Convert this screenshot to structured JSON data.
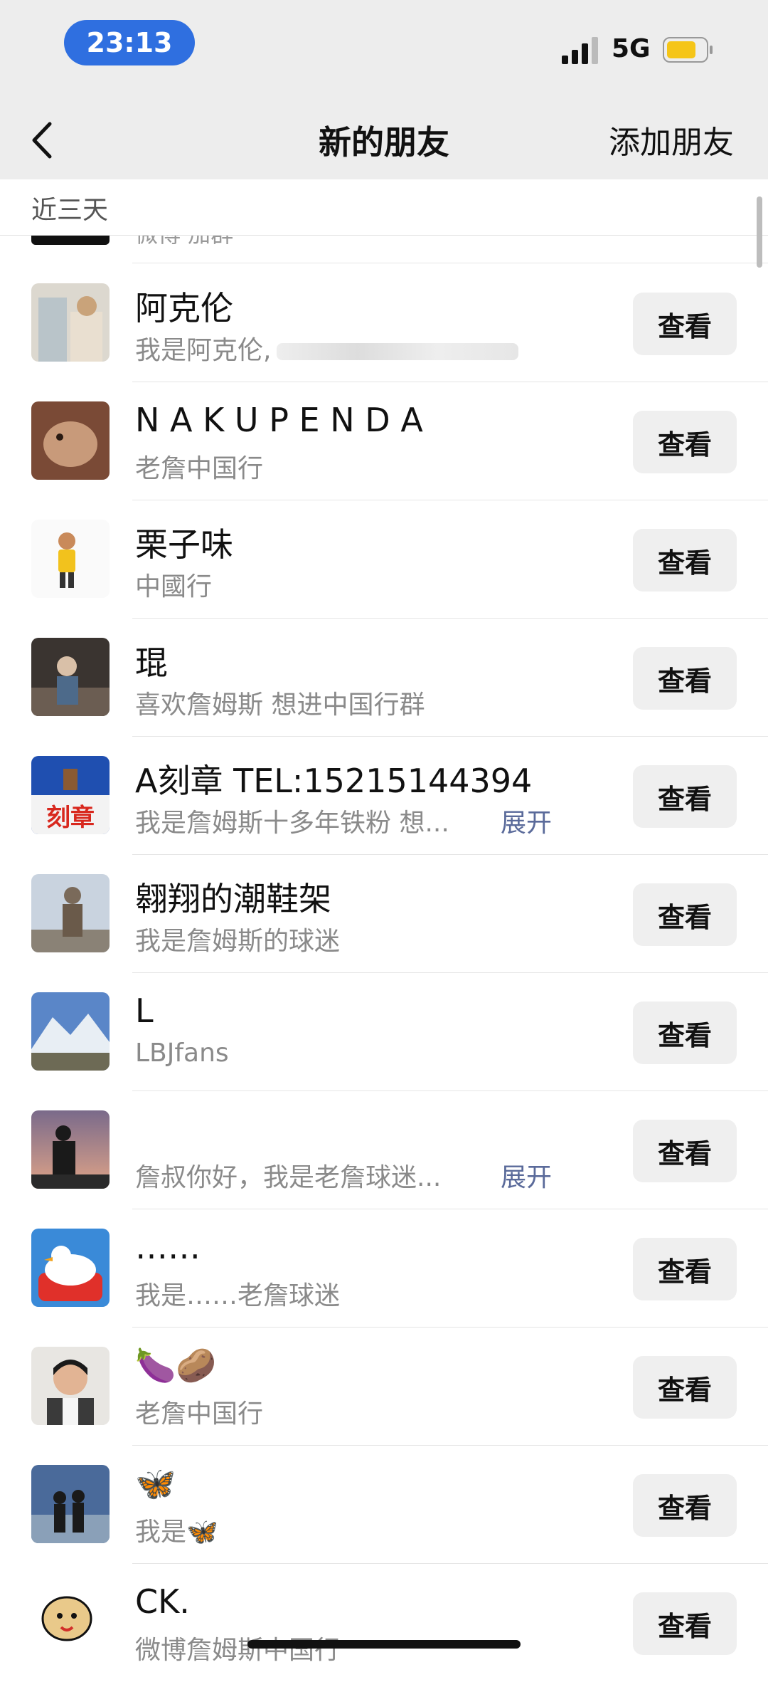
{
  "status_bar": {
    "time": "23:13",
    "network": "5G"
  },
  "nav": {
    "title": "新的朋友",
    "action": "添加朋友"
  },
  "section": {
    "label": "近三天"
  },
  "partial_row": {
    "message": "微博 加群"
  },
  "rows": [
    {
      "name": "阿克伦",
      "message": "我是阿克伦,",
      "button": "查看",
      "avatar_icon": "photo-avatar"
    },
    {
      "name": "N A K U P E N D A",
      "message": "老詹中国行",
      "button": "查看",
      "avatar_icon": "photo-avatar"
    },
    {
      "name": "栗子味",
      "message": "中國行",
      "button": "查看",
      "avatar_icon": "photo-avatar"
    },
    {
      "name": "琨",
      "message": "喜欢詹姆斯 想进中国行群",
      "button": "查看",
      "avatar_icon": "photo-avatar"
    },
    {
      "name": "A刻章 TEL:15215144394",
      "message": "我是詹姆斯十多年铁粉 想...",
      "expand": "展开",
      "button": "查看",
      "avatar_icon": "stamp-avatar",
      "avatar_text": "刻章"
    },
    {
      "name": "翱翔的潮鞋架",
      "message": "我是詹姆斯的球迷",
      "button": "查看",
      "avatar_icon": "photo-avatar"
    },
    {
      "name": "L",
      "message": "LBJfans",
      "button": "查看",
      "avatar_icon": "photo-avatar"
    },
    {
      "name": "",
      "message": "詹叔你好，我是老詹球迷...",
      "expand": "展开",
      "button": "查看",
      "avatar_icon": "photo-avatar"
    },
    {
      "name": "……",
      "message": "我是……老詹球迷",
      "button": "查看",
      "avatar_icon": "photo-avatar"
    },
    {
      "name": "🍆🥔",
      "message": "老詹中国行",
      "button": "查看",
      "avatar_icon": "photo-avatar"
    },
    {
      "name": "🦋",
      "message": "我是🦋",
      "button": "查看",
      "avatar_icon": "photo-avatar"
    },
    {
      "name": "CK.",
      "message": "微博詹姆斯中国行",
      "button": "查看",
      "avatar_icon": "photo-avatar"
    }
  ]
}
